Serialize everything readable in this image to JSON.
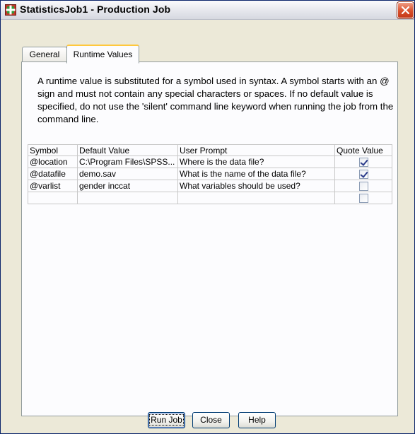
{
  "window": {
    "title": "StatisticsJob1 - Production Job"
  },
  "tabs": [
    {
      "label": "General",
      "active": false
    },
    {
      "label": "Runtime Values",
      "active": true
    }
  ],
  "description": "A runtime value is substituted for a symbol used in syntax. A symbol starts with an @ sign and must not contain any special characters or spaces. If no default value is specified, do not use the 'silent' command line keyword when running the job from the command line.",
  "table": {
    "headers": [
      "Symbol",
      "Default Value",
      "User Prompt",
      "Quote Value"
    ],
    "rows": [
      {
        "symbol": "@location",
        "default": "C:\\Program Files\\SPSS...",
        "prompt": "Where is the data file?",
        "quote": true
      },
      {
        "symbol": "@datafile",
        "default": "demo.sav",
        "prompt": "What is the name of the data file?",
        "quote": true
      },
      {
        "symbol": "@varlist",
        "default": "gender inccat",
        "prompt": "What variables should be used?",
        "quote": false
      },
      {
        "symbol": "",
        "default": "",
        "prompt": "",
        "quote": false
      }
    ]
  },
  "buttons": {
    "run": "Run Job",
    "close": "Close",
    "help": "Help"
  },
  "colors": {
    "accent": "#ffc83c",
    "close_button": "#d94f2b",
    "dialog_bg": "#ece9d8"
  },
  "icons": {
    "app": "spss-job-icon",
    "close": "close-icon"
  }
}
